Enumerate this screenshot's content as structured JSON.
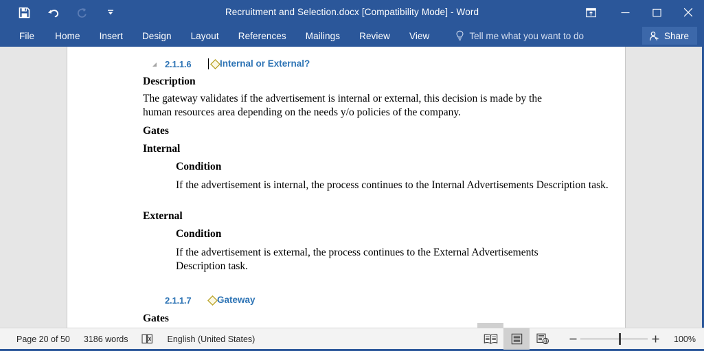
{
  "titlebar": {
    "document_title": "Recruitment and Selection.docx [Compatibility Mode] - Word",
    "quick_access": [
      {
        "name": "save-button",
        "label": "Save"
      },
      {
        "name": "undo-button",
        "label": "Undo"
      },
      {
        "name": "redo-button",
        "label": "Redo"
      },
      {
        "name": "customize-quick-access-button",
        "label": "Customize Quick Access Toolbar"
      }
    ],
    "window_controls": [
      {
        "name": "ribbon-display-options-button",
        "label": "Ribbon Display Options"
      },
      {
        "name": "minimize-button",
        "label": "Minimize"
      },
      {
        "name": "maximize-button",
        "label": "Maximize"
      },
      {
        "name": "close-button",
        "label": "Close"
      }
    ]
  },
  "ribbon": {
    "tabs": [
      {
        "label": "File"
      },
      {
        "label": "Home"
      },
      {
        "label": "Insert"
      },
      {
        "label": "Design"
      },
      {
        "label": "Layout"
      },
      {
        "label": "References"
      },
      {
        "label": "Mailings"
      },
      {
        "label": "Review"
      },
      {
        "label": "View"
      }
    ],
    "tell_me": "Tell me what you want to do",
    "share_label": "Share"
  },
  "document": {
    "heading_1": {
      "number": "2.1.1.6",
      "label": "Internal or External?"
    },
    "description_label": "Description",
    "description_text": "The gateway validates if the advertisement is internal or external, this decision is made by the human resources area depending on the needs y/o policies of the company.",
    "gates_label_1": "Gates",
    "internal_label": "Internal",
    "internal_condition_label": "Condition",
    "internal_condition_text": "If the advertisement is internal, the process continues to the Internal Advertisements Description task.",
    "external_label": "External",
    "external_condition_label": "Condition",
    "external_condition_text": "If the advertisement is external, the process continues to the External Advertisements Description task.",
    "heading_2": {
      "number": "2.1.1.7",
      "label": "Gateway"
    },
    "gates_label_2": "Gates"
  },
  "statusbar": {
    "page_indicator": "Page 20 of 50",
    "word_count": "3186 words",
    "proofing_label": "Proofing errors",
    "language": "English (United States)",
    "views": [
      {
        "name": "read-mode-view-button",
        "label": "Read Mode",
        "active": false
      },
      {
        "name": "print-layout-view-button",
        "label": "Print Layout",
        "active": true
      },
      {
        "name": "web-layout-view-button",
        "label": "Web Layout",
        "active": false
      }
    ],
    "zoom_out_label": "Zoom Out",
    "zoom_in_label": "Zoom In",
    "zoom_level": "100%"
  },
  "colors": {
    "brand_blue": "#2b579a",
    "share_blue": "#3c68aa",
    "heading_blue": "#2e74b5",
    "gateway_gold": "#b8a125",
    "gateway_fill": "#fbf8e3",
    "workspace_gray": "#e6e6e6",
    "statusbar_gray": "#f3f3f3"
  }
}
